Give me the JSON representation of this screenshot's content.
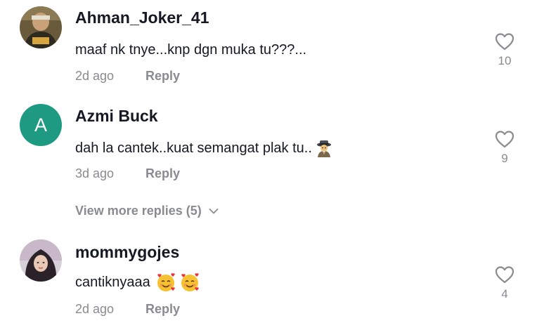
{
  "comments": [
    {
      "username": "Ahman_Joker_41",
      "text": "maaf nk tnye...knp dgn muka tu???...",
      "time": "2d ago",
      "reply_label": "Reply",
      "likes": "10",
      "avatar": "photo"
    },
    {
      "username": "Azmi Buck",
      "text": "dah la cantek..kuat semangat plak tu..",
      "emoji": "detective-emoji",
      "time": "3d ago",
      "reply_label": "Reply",
      "likes": "9",
      "avatar_letter": "A",
      "avatar_color": "#1e9a82"
    },
    {
      "username": "mommygojes",
      "text": "cantiknyaaa",
      "emoji": "smiling-face-with-hearts-emoji",
      "time": "2d ago",
      "reply_label": "Reply",
      "likes": "4",
      "avatar": "photo"
    }
  ],
  "view_more_replies": "View more replies (5)",
  "colors": {
    "text_primary": "#161823",
    "text_secondary": "#8a8b91",
    "avatar_green": "#1e9a82"
  }
}
